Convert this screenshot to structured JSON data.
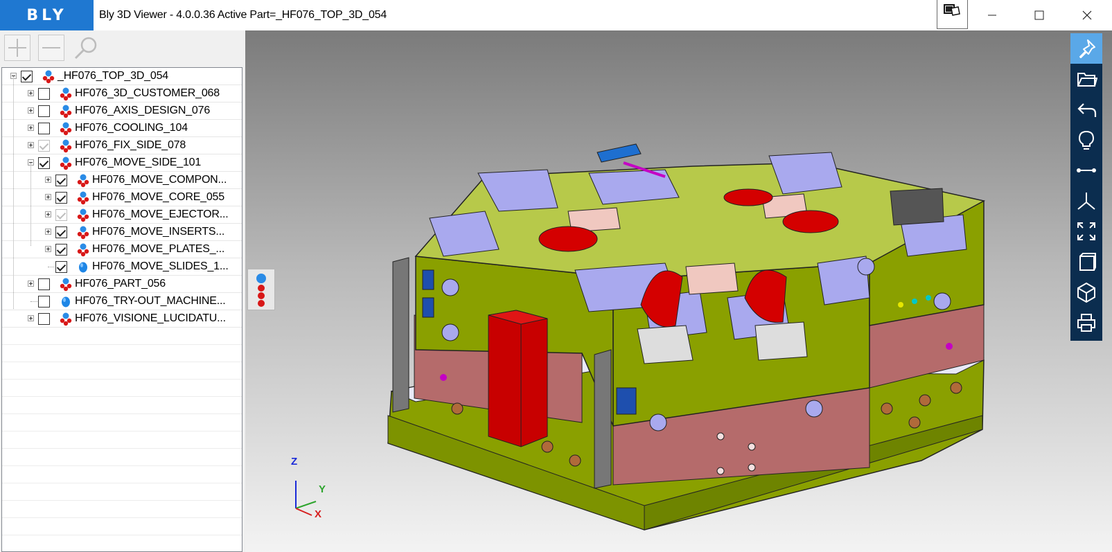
{
  "app": {
    "logo_text": "BLY",
    "window_title": "Bly 3D Viewer - 4.0.0.36 Active Part=_HF076_TOP_3D_054"
  },
  "colors": {
    "accent": "#1f78d1",
    "sidebar_bg": "#0b2d4f",
    "sidebar_active": "#5aa8e8",
    "mold_green": "#8aa000",
    "mold_lavender": "#a9a9ee",
    "mold_pink": "#b56b6b",
    "mold_red": "#d40000"
  },
  "toolbar": {
    "expand_icon": "plus-icon",
    "collapse_icon": "minus-icon",
    "search_icon": "search-icon"
  },
  "tree": {
    "items": [
      {
        "label": "_HF076_TOP_3D_054",
        "depth": 0,
        "expander": "minus",
        "check": "checked",
        "icon": "assembly-icon"
      },
      {
        "label": "HF076_3D_CUSTOMER_068",
        "depth": 1,
        "expander": "plus",
        "check": "unchecked",
        "icon": "assembly-icon"
      },
      {
        "label": "HF076_AXIS_DESIGN_076",
        "depth": 1,
        "expander": "plus",
        "check": "unchecked",
        "icon": "assembly-icon"
      },
      {
        "label": "HF076_COOLING_104",
        "depth": 1,
        "expander": "plus",
        "check": "unchecked",
        "icon": "assembly-icon"
      },
      {
        "label": "HF076_FIX_SIDE_078",
        "depth": 1,
        "expander": "plus",
        "check": "grey",
        "icon": "assembly-icon"
      },
      {
        "label": "HF076_MOVE_SIDE_101",
        "depth": 1,
        "expander": "minus",
        "check": "checked",
        "icon": "assembly-icon"
      },
      {
        "label": "HF076_MOVE_COMPON...",
        "depth": 2,
        "expander": "plus",
        "check": "checked",
        "icon": "assembly-icon"
      },
      {
        "label": "HF076_MOVE_CORE_055",
        "depth": 2,
        "expander": "plus",
        "check": "checked",
        "icon": "assembly-icon"
      },
      {
        "label": "HF076_MOVE_EJECTOR...",
        "depth": 2,
        "expander": "plus",
        "check": "grey",
        "icon": "assembly-icon"
      },
      {
        "label": "HF076_MOVE_INSERTS...",
        "depth": 2,
        "expander": "plus",
        "check": "checked",
        "icon": "assembly-icon"
      },
      {
        "label": "HF076_MOVE_PLATES_...",
        "depth": 2,
        "expander": "plus",
        "check": "checked",
        "icon": "assembly-icon"
      },
      {
        "label": "HF076_MOVE_SLIDES_1...",
        "depth": 2,
        "expander": "none",
        "check": "checked",
        "icon": "part-icon"
      },
      {
        "label": "HF076_PART_056",
        "depth": 1,
        "expander": "plus",
        "check": "unchecked",
        "icon": "assembly-icon"
      },
      {
        "label": "HF076_TRY-OUT_MACHINE...",
        "depth": 1,
        "expander": "none",
        "check": "unchecked",
        "icon": "part-icon"
      },
      {
        "label": "HF076_VISIONE_LUCIDATU...",
        "depth": 1,
        "expander": "plus",
        "check": "unchecked",
        "icon": "assembly-icon"
      }
    ]
  },
  "sidebar": {
    "buttons": [
      {
        "icon": "pin-icon",
        "active": true
      },
      {
        "icon": "open-folder-icon",
        "active": false
      },
      {
        "icon": "undo-icon",
        "active": false
      },
      {
        "icon": "lightbulb-icon",
        "active": false
      },
      {
        "icon": "measure-icon",
        "active": false
      },
      {
        "icon": "axes-icon",
        "active": false
      },
      {
        "icon": "fit-view-icon",
        "active": false
      },
      {
        "icon": "section-box-icon",
        "active": false
      },
      {
        "icon": "cube-view-icon",
        "active": false
      },
      {
        "icon": "print-icon",
        "active": false
      }
    ]
  },
  "axis_triad": {
    "z": "Z",
    "y": "Y",
    "x": "X"
  }
}
